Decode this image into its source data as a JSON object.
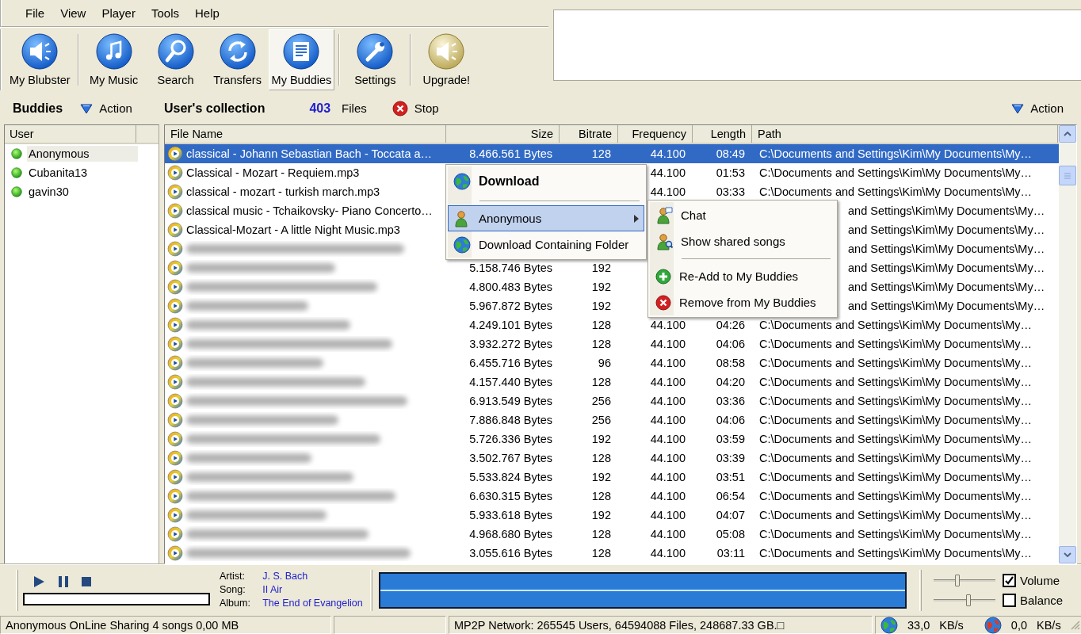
{
  "menu_bar": [
    "File",
    "View",
    "Player",
    "Tools",
    "Help"
  ],
  "toolbar": [
    {
      "label": "My Blubster",
      "selected": false
    },
    {
      "label": "My Music",
      "selected": false
    },
    {
      "label": "Search",
      "selected": false
    },
    {
      "label": "Transfers",
      "selected": false
    },
    {
      "label": "My Buddies",
      "selected": true
    },
    {
      "label": "Settings",
      "selected": false
    },
    {
      "label": "Upgrade!",
      "selected": false
    }
  ],
  "buddies": {
    "title": "Buddies",
    "action": "Action",
    "columns": [
      "User"
    ],
    "users": [
      {
        "name": "Anonymous",
        "selected": true
      },
      {
        "name": "Cubanita13",
        "selected": false
      },
      {
        "name": "gavin30",
        "selected": false
      }
    ]
  },
  "collection": {
    "title": "User's collection",
    "count": "403",
    "count_label": "Files",
    "stop": "Stop",
    "action": "Action"
  },
  "table": {
    "columns": [
      "File Name",
      "Size",
      "Bitrate",
      "Frequency",
      "Length",
      "Path"
    ],
    "rows": [
      {
        "file_name": "classical - Johann Sebastian Bach - Toccata a…",
        "size": "8.466.561 Bytes",
        "bitrate": "128",
        "frequency": "44.100",
        "length": "08:49",
        "path": "C:\\Documents and Settings\\Kim\\My Documents\\My…",
        "selected": true,
        "blurred": false,
        "path_covered": false
      },
      {
        "file_name": "Classical - Mozart - Requiem.mp3",
        "frequency": "44.100",
        "length": "01:53",
        "path": "C:\\Documents and Settings\\Kim\\My Documents\\My…",
        "selected": false,
        "blurred": false,
        "path_covered": false
      },
      {
        "file_name": "classical - mozart - turkish march.mp3",
        "frequency": "44.100",
        "length": "03:33",
        "path": "C:\\Documents and Settings\\Kim\\My Documents\\My…",
        "selected": false,
        "blurred": false,
        "path_covered": false
      },
      {
        "file_name": "classical music - Tchaikovsky- Piano Concerto…",
        "path": "and Settings\\Kim\\My Documents\\My…",
        "selected": false,
        "blurred": false,
        "path_covered": true
      },
      {
        "file_name": "Classical-Mozart - A little Night Music.mp3",
        "path": "and Settings\\Kim\\My Documents\\My…",
        "selected": false,
        "blurred": false,
        "path_covered": true
      },
      {
        "path": "and Settings\\Kim\\My Documents\\My…",
        "selected": false,
        "blurred": true,
        "path_covered": true
      },
      {
        "size": "5.158.746 Bytes",
        "bitrate": "192",
        "path": "and Settings\\Kim\\My Documents\\My…",
        "selected": false,
        "blurred": true,
        "path_covered": true
      },
      {
        "size": "4.800.483 Bytes",
        "bitrate": "192",
        "path": "and Settings\\Kim\\My Documents\\My…",
        "selected": false,
        "blurred": true,
        "path_covered": true
      },
      {
        "size": "5.967.872 Bytes",
        "bitrate": "192",
        "path": "and Settings\\Kim\\My Documents\\My…",
        "selected": false,
        "blurred": true,
        "path_covered": true
      },
      {
        "size": "4.249.101 Bytes",
        "bitrate": "128",
        "frequency": "44.100",
        "length": "04:26",
        "path": "C:\\Documents and Settings\\Kim\\My Documents\\My…",
        "selected": false,
        "blurred": true,
        "path_covered": false
      },
      {
        "size": "3.932.272 Bytes",
        "bitrate": "128",
        "frequency": "44.100",
        "length": "04:06",
        "path": "C:\\Documents and Settings\\Kim\\My Documents\\My…",
        "selected": false,
        "blurred": true,
        "path_covered": false
      },
      {
        "size": "6.455.716 Bytes",
        "bitrate": "96",
        "frequency": "44.100",
        "length": "08:58",
        "path": "C:\\Documents and Settings\\Kim\\My Documents\\My…",
        "selected": false,
        "blurred": true,
        "path_covered": false
      },
      {
        "size": "4.157.440 Bytes",
        "bitrate": "128",
        "frequency": "44.100",
        "length": "04:20",
        "path": "C:\\Documents and Settings\\Kim\\My Documents\\My…",
        "selected": false,
        "blurred": true,
        "path_covered": false
      },
      {
        "size": "6.913.549 Bytes",
        "bitrate": "256",
        "frequency": "44.100",
        "length": "03:36",
        "path": "C:\\Documents and Settings\\Kim\\My Documents\\My…",
        "selected": false,
        "blurred": true,
        "path_covered": false
      },
      {
        "size": "7.886.848 Bytes",
        "bitrate": "256",
        "frequency": "44.100",
        "length": "04:06",
        "path": "C:\\Documents and Settings\\Kim\\My Documents\\My…",
        "selected": false,
        "blurred": true,
        "path_covered": false
      },
      {
        "size": "5.726.336 Bytes",
        "bitrate": "192",
        "frequency": "44.100",
        "length": "03:59",
        "path": "C:\\Documents and Settings\\Kim\\My Documents\\My…",
        "selected": false,
        "blurred": true,
        "path_covered": false
      },
      {
        "size": "3.502.767 Bytes",
        "bitrate": "128",
        "frequency": "44.100",
        "length": "03:39",
        "path": "C:\\Documents and Settings\\Kim\\My Documents\\My…",
        "selected": false,
        "blurred": true,
        "path_covered": false
      },
      {
        "size": "5.533.824 Bytes",
        "bitrate": "192",
        "frequency": "44.100",
        "length": "03:51",
        "path": "C:\\Documents and Settings\\Kim\\My Documents\\My…",
        "selected": false,
        "blurred": true,
        "path_covered": false
      },
      {
        "size": "6.630.315 Bytes",
        "bitrate": "128",
        "frequency": "44.100",
        "length": "06:54",
        "path": "C:\\Documents and Settings\\Kim\\My Documents\\My…",
        "selected": false,
        "blurred": true,
        "path_covered": false
      },
      {
        "size": "5.933.618 Bytes",
        "bitrate": "192",
        "frequency": "44.100",
        "length": "04:07",
        "path": "C:\\Documents and Settings\\Kim\\My Documents\\My…",
        "selected": false,
        "blurred": true,
        "path_covered": false
      },
      {
        "size": "4.968.680 Bytes",
        "bitrate": "128",
        "frequency": "44.100",
        "length": "05:08",
        "path": "C:\\Documents and Settings\\Kim\\My Documents\\My…",
        "selected": false,
        "blurred": true,
        "path_covered": false
      },
      {
        "size": "3.055.616 Bytes",
        "bitrate": "128",
        "frequency": "44.100",
        "length": "03:11",
        "path": "C:\\Documents and Settings\\Kim\\My Documents\\My…",
        "selected": false,
        "blurred": true,
        "path_covered": false
      }
    ]
  },
  "context_menu": {
    "items": [
      {
        "label": "Download",
        "default": true,
        "submenu": false,
        "selected": false
      },
      {
        "label": "Anonymous",
        "default": false,
        "submenu": true,
        "selected": true
      },
      {
        "label": "Download Containing Folder",
        "default": false,
        "submenu": false,
        "selected": false
      }
    ]
  },
  "submenu": {
    "items": [
      {
        "label": "Chat"
      },
      {
        "label": "Show shared songs"
      },
      {
        "label": "Re-Add to My Buddies"
      },
      {
        "label": "Remove from My Buddies"
      }
    ]
  },
  "player": {
    "progress": {
      "level": 0
    },
    "info": [
      {
        "label": "Artist:",
        "value": "J. S. Bach"
      },
      {
        "label": "Song:",
        "value": "II Air"
      },
      {
        "label": "Album:",
        "value": "The End of Evangelion"
      }
    ],
    "volume": {
      "label": "Volume",
      "checked": true,
      "level": 0.39
    },
    "balance": {
      "label": "Balance",
      "checked": false,
      "level": 0.56
    }
  },
  "status_bar": {
    "message": "Anonymous OnLine Sharing 4 songs 0,00 MB",
    "network": "MP2P Network: 265545 Users, 64594088 Files, 248687.33 GB.□",
    "download_rate": "33,0",
    "download_unit": "KB/s",
    "upload_rate": "0,0",
    "upload_unit": "KB/s"
  }
}
